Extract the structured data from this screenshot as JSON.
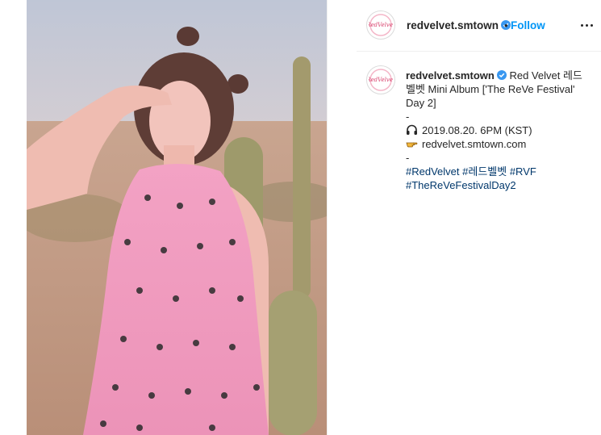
{
  "post": {
    "image_alt": "Woman in a pink halter dress posing among desert cacti",
    "account": {
      "username": "redvelvet.smtown",
      "verified": true,
      "follow_label": "Follow",
      "separator": "•",
      "avatar_text": "Red Velvet"
    },
    "caption": {
      "username": "redvelvet.smtown",
      "line1": "Red Velvet 레드",
      "line2": "벨벳 Mini Album ['The ReVe Festival'",
      "line3": "Day 2]",
      "dash1": "-",
      "datetime": "2019.08.20. 6PM (KST)",
      "datetime_icon": "headphones-icon",
      "link": "redvelvet.smtown.com",
      "link_icon": "pointing-hand-icon",
      "dash2": "-",
      "hashtags_line1": [
        "#RedVelvet",
        "#레드벨벳",
        "#RVF"
      ],
      "hashtags_line2": [
        "#TheReVeFestivalDay2"
      ]
    }
  },
  "colors": {
    "follow_blue": "#0095f6",
    "hashtag": "#00376b",
    "verified_blue": "#3897f0",
    "dress_pink": "#f09cc0"
  }
}
